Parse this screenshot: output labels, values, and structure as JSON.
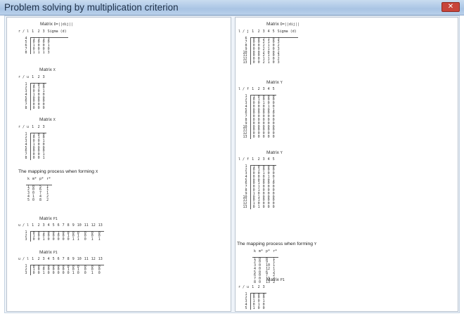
{
  "window": {
    "title": "Problem solving by multiplication criterion",
    "close_label": "✕"
  },
  "left": {
    "matrix_d": {
      "title": "Matrix",
      "sub": "D=||dij||",
      "corner": "r / l",
      "cols": [
        "1",
        "2",
        "3",
        "Sigma (d)"
      ],
      "rows": [
        [
          "4",
          [
            "1",
            "1",
            "1",
            "3"
          ]
        ],
        [
          "5",
          [
            "0",
            "0",
            "0",
            "0"
          ]
        ],
        [
          "6",
          [
            "1",
            "0",
            "0",
            "1"
          ]
        ],
        [
          "7",
          [
            "0",
            "0",
            "0",
            "0"
          ]
        ],
        [
          "8",
          [
            "1",
            "1",
            "1",
            "3"
          ]
        ]
      ]
    },
    "matrix_x": {
      "title": "Matrix",
      "sub": "X",
      "corner": "r / u",
      "cols": [
        "1",
        "2",
        "3"
      ],
      "rows": [
        [
          "1",
          [
            "1",
            "0",
            "0"
          ]
        ],
        [
          "2",
          [
            "0",
            "1",
            "0"
          ]
        ],
        [
          "3",
          [
            "0",
            "0",
            "1"
          ]
        ],
        [
          "4",
          [
            "1",
            "0",
            "0"
          ]
        ],
        [
          "5",
          [
            "0",
            "0",
            "0"
          ]
        ],
        [
          "6",
          [
            "0",
            "0",
            "0"
          ]
        ],
        [
          "7",
          [
            "0",
            "0",
            "0"
          ]
        ],
        [
          "8",
          [
            "0",
            "0",
            "0"
          ]
        ]
      ]
    },
    "matrix_x2": {
      "title": "Matrix",
      "sub": "X",
      "corner": "r / u",
      "cols": [
        "1",
        "2",
        "3"
      ],
      "rows": [
        [
          "1",
          [
            "1",
            "0",
            "0"
          ]
        ],
        [
          "2",
          [
            "0",
            "1",
            "0"
          ]
        ],
        [
          "3",
          [
            "0",
            "0",
            "1"
          ]
        ],
        [
          "4",
          [
            "1",
            "0",
            "0"
          ]
        ],
        [
          "5",
          [
            "0",
            "0",
            "0"
          ]
        ],
        [
          "6",
          [
            "0",
            "0",
            "0"
          ]
        ],
        [
          "7",
          [
            "0",
            "0",
            "1"
          ]
        ],
        [
          "8",
          [
            "0",
            "0",
            "1"
          ]
        ]
      ]
    },
    "mapping": {
      "heading": "The mapping process when forming",
      "var": "X",
      "cols": [
        "k",
        "m*",
        "p*",
        "r*"
      ],
      "rows": [
        [
          "1",
          "0",
          "5",
          "1"
        ],
        [
          "2",
          "0",
          "6",
          "1"
        ],
        [
          "3",
          "0",
          "7",
          "1"
        ],
        [
          "4",
          "1",
          "4",
          "2"
        ],
        [
          "5",
          "0",
          "8",
          "2"
        ]
      ]
    },
    "matrix_p1": {
      "title": "Matrix",
      "sub": "P1",
      "corner": "u / l",
      "cols": [
        "1",
        "2",
        "3",
        "4",
        "5",
        "6",
        "7",
        "8",
        "9",
        "10",
        "11",
        "12",
        "13"
      ],
      "rows": [
        [
          "1",
          [
            "0",
            "0",
            "1",
            "0",
            "0",
            "1",
            "0",
            "0",
            "0",
            "0",
            "0",
            "0",
            "0"
          ]
        ],
        [
          "2",
          [
            "1",
            "0",
            "0",
            "0",
            "0",
            "0",
            "0",
            "1",
            "0",
            "1",
            "0",
            "0",
            "0"
          ]
        ],
        [
          "3",
          [
            "0",
            "0",
            "1",
            "0",
            "0",
            "0",
            "0",
            "0",
            "1",
            "1",
            "0",
            "1",
            "1"
          ]
        ]
      ]
    },
    "matrix_p1b": {
      "title": "Matrix",
      "sub": "P1",
      "corner": "u / l",
      "cols": [
        "1",
        "2",
        "3",
        "4",
        "5",
        "6",
        "7",
        "8",
        "9",
        "10",
        "11",
        "12",
        "13"
      ],
      "rows": [
        [
          "1",
          [
            "0",
            "0",
            "1",
            "0",
            "0",
            "0",
            "0",
            "0",
            "0",
            "0",
            "0",
            "0",
            "0"
          ]
        ],
        [
          "2",
          [
            "1",
            "0",
            "0",
            "0",
            "0",
            "0",
            "0",
            "1",
            "0",
            "1",
            "0",
            "0",
            "0"
          ]
        ],
        [
          "3",
          [
            "0",
            "0",
            "1",
            "0",
            "0",
            "0",
            "0",
            "0",
            "1",
            "0",
            "0",
            "1",
            "0"
          ]
        ]
      ]
    }
  },
  "right": {
    "matrix_d": {
      "title": "Matrix",
      "sub": "D=||dij||",
      "corner": "l / j",
      "cols": [
        "1",
        "2",
        "3",
        "4",
        "5",
        "Sigma (d)"
      ],
      "rows": [
        [
          "6",
          [
            "0",
            "0",
            "2",
            "1",
            "0",
            "3"
          ]
        ],
        [
          "7",
          [
            "0",
            "0",
            "2",
            "1",
            "0",
            "3"
          ]
        ],
        [
          "8",
          [
            "0",
            "0",
            "2",
            "1",
            "0",
            "2"
          ]
        ],
        [
          "9",
          [
            "0",
            "0",
            "2",
            "1",
            "0",
            "3"
          ]
        ],
        [
          "10",
          [
            "0",
            "0",
            "2",
            "0",
            "0",
            "2"
          ]
        ],
        [
          "11",
          [
            "0",
            "0",
            "2",
            "1",
            "0",
            "3"
          ]
        ],
        [
          "12",
          [
            "0",
            "0",
            "1",
            "1",
            "0",
            "2"
          ]
        ],
        [
          "13",
          [
            "0",
            "0",
            "2",
            "1",
            "0",
            "3"
          ]
        ]
      ]
    },
    "matrix_y": {
      "title": "Matrix",
      "sub": "Y",
      "corner": "l / f",
      "cols": [
        "1",
        "2",
        "3",
        "4",
        "5"
      ],
      "rows": [
        [
          "1",
          [
            "1",
            "0",
            "0",
            "0",
            "0"
          ]
        ],
        [
          "2",
          [
            "0",
            "1",
            "0",
            "0",
            "0"
          ]
        ],
        [
          "3",
          [
            "0",
            "0",
            "1",
            "0",
            "0"
          ]
        ],
        [
          "4",
          [
            "0",
            "0",
            "0",
            "1",
            "0"
          ]
        ],
        [
          "5",
          [
            "0",
            "0",
            "0",
            "0",
            "1"
          ]
        ],
        [
          "6",
          [
            "0",
            "0",
            "0",
            "0",
            "0"
          ]
        ],
        [
          "7",
          [
            "0",
            "0",
            "0",
            "0",
            "0"
          ]
        ],
        [
          "8",
          [
            "0",
            "0",
            "0",
            "0",
            "0"
          ]
        ],
        [
          "9",
          [
            "0",
            "0",
            "0",
            "0",
            "0"
          ]
        ],
        [
          "10",
          [
            "0",
            "0",
            "0",
            "0",
            "0"
          ]
        ],
        [
          "11",
          [
            "0",
            "0",
            "0",
            "0",
            "0"
          ]
        ],
        [
          "12",
          [
            "0",
            "0",
            "0",
            "0",
            "0"
          ]
        ],
        [
          "13",
          [
            "0",
            "0",
            "0",
            "0",
            "0"
          ]
        ]
      ]
    },
    "matrix_y2": {
      "title": "Matrix",
      "sub": "Y",
      "corner": "l / f",
      "cols": [
        "1",
        "2",
        "3",
        "4",
        "5"
      ],
      "rows": [
        [
          "1",
          [
            "1",
            "0",
            "0",
            "0",
            "0"
          ]
        ],
        [
          "2",
          [
            "0",
            "1",
            "0",
            "0",
            "0"
          ]
        ],
        [
          "3",
          [
            "0",
            "0",
            "1",
            "0",
            "0"
          ]
        ],
        [
          "4",
          [
            "0",
            "0",
            "0",
            "1",
            "0"
          ]
        ],
        [
          "5",
          [
            "0",
            "0",
            "0",
            "0",
            "1"
          ]
        ],
        [
          "6",
          [
            "0",
            "1",
            "0",
            "0",
            "0"
          ]
        ],
        [
          "7",
          [
            "0",
            "1",
            "0",
            "0",
            "0"
          ]
        ],
        [
          "8",
          [
            "0",
            "1",
            "0",
            "0",
            "0"
          ]
        ],
        [
          "9",
          [
            "1",
            "0",
            "0",
            "0",
            "0"
          ]
        ],
        [
          "10",
          [
            "0",
            "1",
            "0",
            "0",
            "0"
          ]
        ],
        [
          "11",
          [
            "0",
            "1",
            "0",
            "0",
            "0"
          ]
        ],
        [
          "12",
          [
            "1",
            "0",
            "0",
            "0",
            "0"
          ]
        ],
        [
          "13",
          [
            "0",
            "1",
            "0",
            "0",
            "0"
          ]
        ]
      ]
    },
    "mapping": {
      "heading": "The mapping process when forming",
      "var": "Y",
      "cols": [
        "k",
        "m*",
        "p*",
        "r*"
      ],
      "rows": [
        [
          "1",
          "0",
          "8",
          "1"
        ],
        [
          "2",
          "0",
          "9",
          "1"
        ],
        [
          "3",
          "0",
          "10",
          "1"
        ],
        [
          "4",
          "0",
          "12",
          "1"
        ],
        [
          "5",
          "0",
          "6",
          "2"
        ],
        [
          "6",
          "0",
          "7",
          "2"
        ],
        [
          "7",
          "0",
          "11",
          "2"
        ],
        [
          "8",
          "0",
          "13",
          "2"
        ]
      ]
    },
    "matrix_p1": {
      "title": "Matrix",
      "sub": "P1",
      "corner": "r / u",
      "cols": [
        "1",
        "2",
        "3"
      ],
      "rows": [
        [
          "1",
          [
            "0",
            "0",
            "0"
          ]
        ],
        [
          "2",
          [
            "0",
            "0",
            "0"
          ]
        ],
        [
          "3",
          [
            "1",
            "0",
            "1"
          ]
        ],
        [
          "4",
          [
            "0",
            "1",
            "0"
          ]
        ],
        [
          "5",
          [
            "1",
            "0",
            "0"
          ]
        ]
      ]
    }
  }
}
